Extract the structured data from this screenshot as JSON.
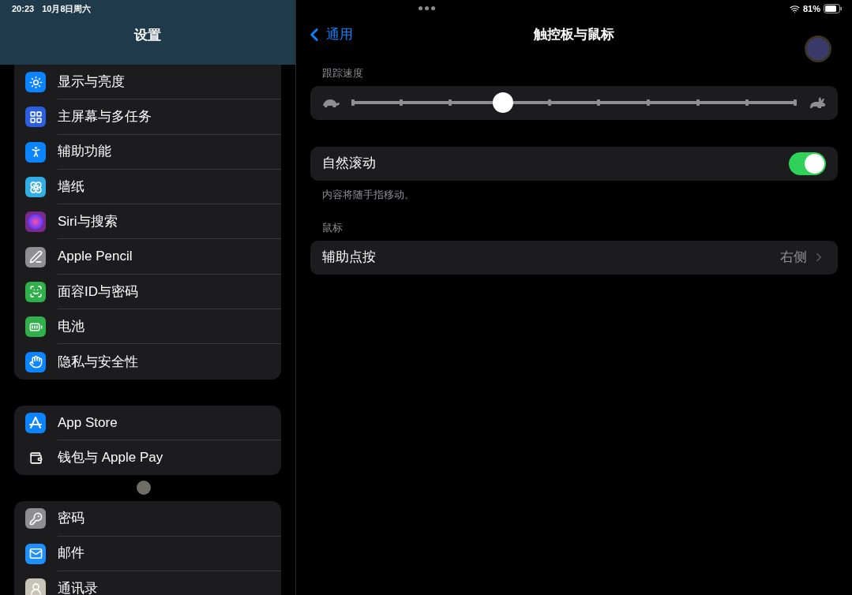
{
  "status_bar": {
    "time": "20:23",
    "date": "10月8日周六",
    "battery": "81%"
  },
  "sidebar": {
    "title": "设置",
    "groups": [
      {
        "items": [
          {
            "label": "显示与亮度"
          },
          {
            "label": "主屏幕与多任务"
          },
          {
            "label": "辅助功能"
          },
          {
            "label": "墙纸"
          },
          {
            "label": "Siri与搜索"
          },
          {
            "label": "Apple Pencil"
          },
          {
            "label": "面容ID与密码"
          },
          {
            "label": "电池"
          },
          {
            "label": "隐私与安全性"
          }
        ]
      },
      {
        "items": [
          {
            "label": "App Store"
          },
          {
            "label": "钱包与 Apple Pay"
          }
        ]
      },
      {
        "items": [
          {
            "label": "密码"
          },
          {
            "label": "邮件"
          },
          {
            "label": "通讯录"
          }
        ]
      }
    ]
  },
  "detail": {
    "back": "通用",
    "title": "触控板与鼠标",
    "tracking": {
      "header": "跟踪速度",
      "level": 0.333
    },
    "natural_scroll": {
      "label": "自然滚动",
      "on": true,
      "footer": "内容将随手指移动。"
    },
    "mouse": {
      "header": "鼠标",
      "row": {
        "label": "辅助点按",
        "value": "右侧"
      }
    }
  }
}
